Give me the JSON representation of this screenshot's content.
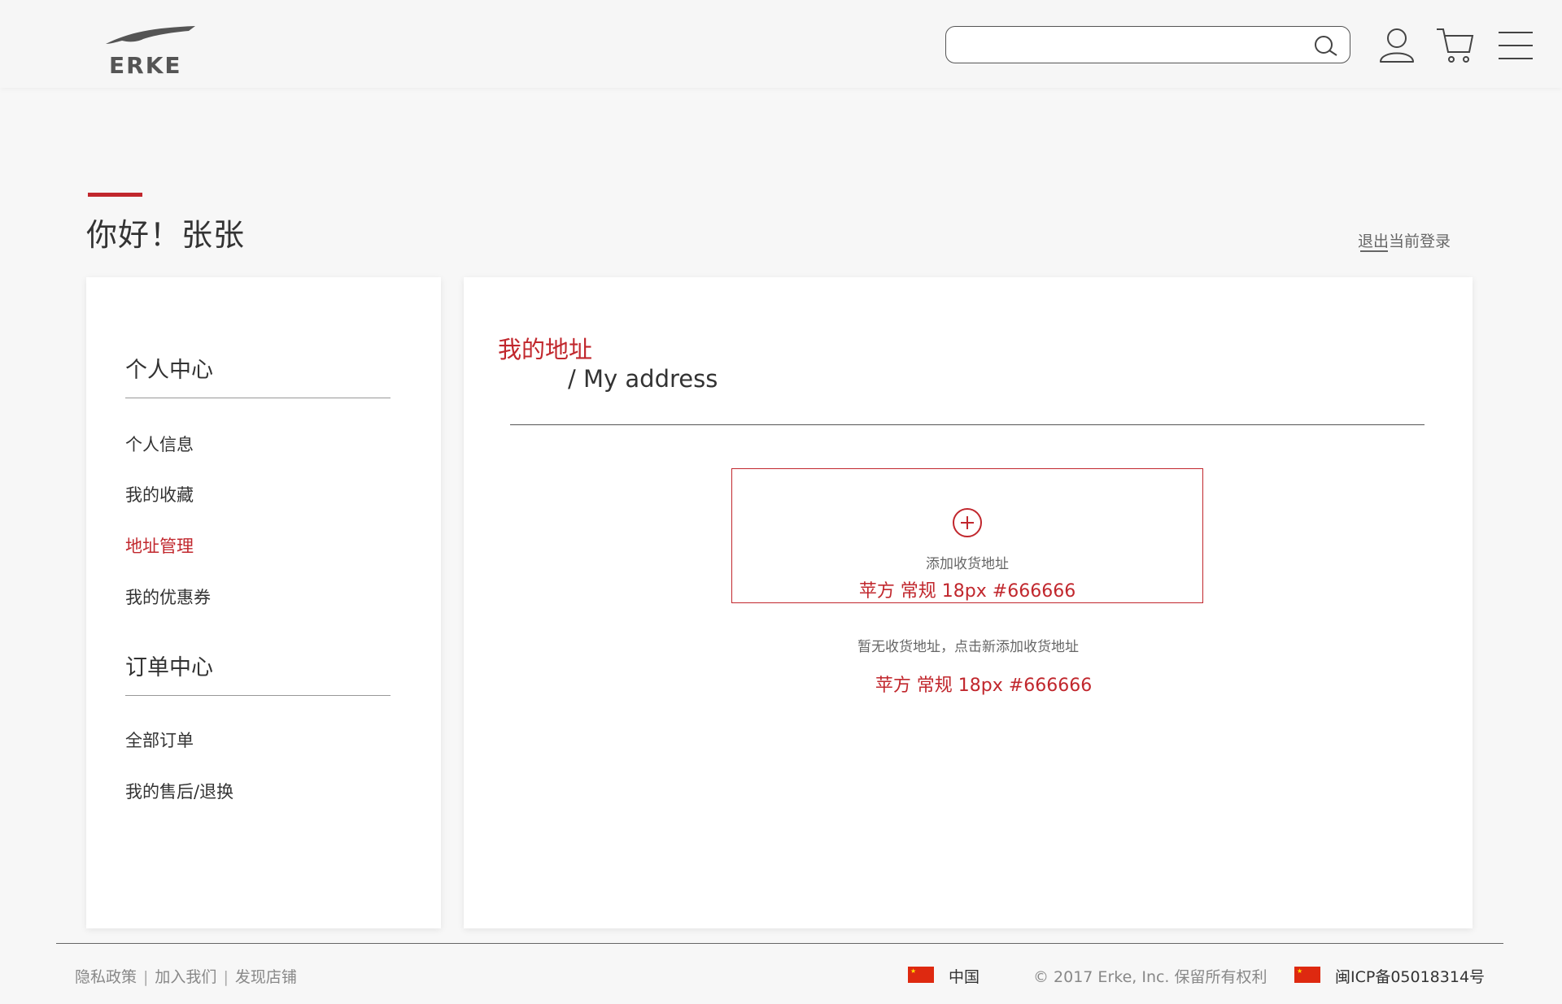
{
  "header": {
    "logo_text": "ERKE",
    "search": {
      "value": "",
      "placeholder": ""
    }
  },
  "greeting": "你好！张张",
  "logout_label": "退出当前登录",
  "sidebar": {
    "sections": [
      {
        "title": "个人中心",
        "items": [
          "个人信息",
          "我的收藏",
          "地址管理",
          "我的优惠券"
        ]
      },
      {
        "title": "订单中心",
        "items": [
          "全部订单",
          "我的售后/退换"
        ]
      }
    ],
    "active_item": "地址管理"
  },
  "main": {
    "title_cn": "我的地址",
    "title_en": "/ My address",
    "add_label": "添加收货地址",
    "spec_note_1": "苹方 常规 18px #666666",
    "empty_text": "暂无收货地址，点击新添加收货地址",
    "spec_note_2": "苹方 常规 18px #666666"
  },
  "footer": {
    "links": [
      "隐私政策",
      "加入我们",
      "发现店铺"
    ],
    "region": "中国",
    "copyright": "© 2017 Erke, Inc. 保留所有权利",
    "icp": "闽ICP备05018314号"
  },
  "colors": {
    "accent": "#c1272d",
    "text": "#333333",
    "muted": "#666666",
    "background": "#f7f7f7"
  }
}
